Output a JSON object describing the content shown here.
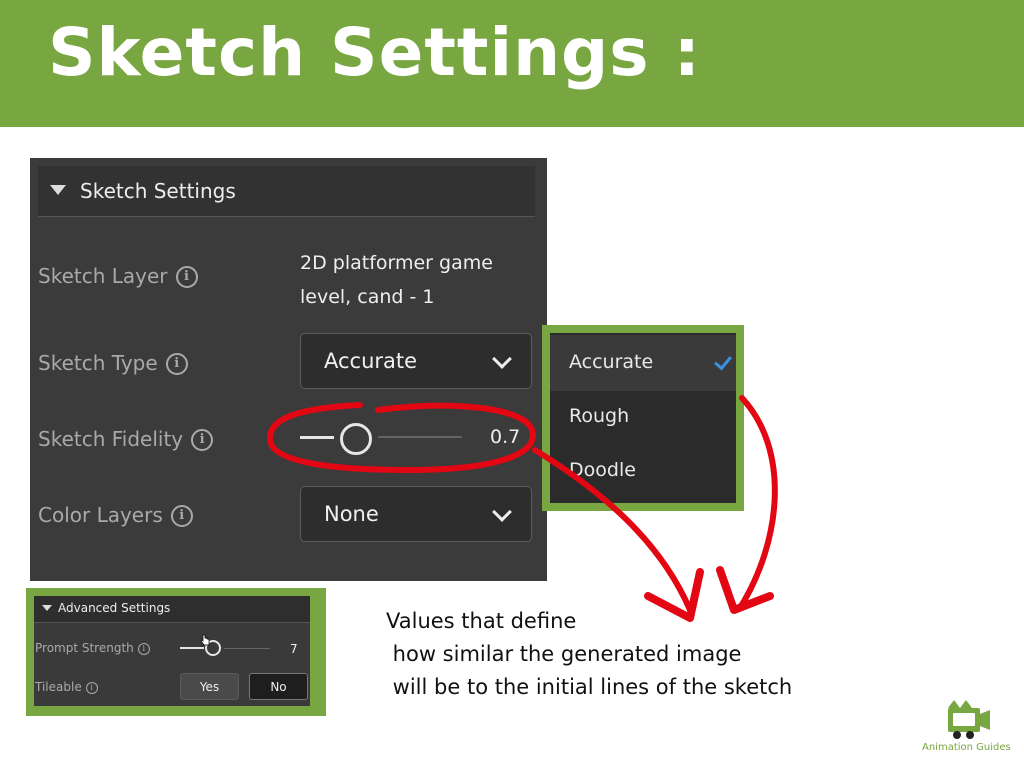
{
  "slide": {
    "title": "Sketch Settings :",
    "header_color": "#78a640",
    "caption_lines": [
      "Values that define",
      " how similar the generated image",
      " will be to the initial lines of the sketch"
    ]
  },
  "panel": {
    "section_title": "Sketch Settings",
    "sketch_layer": {
      "label": "Sketch Layer",
      "value_line1": "2D platformer game",
      "value_line2": "level, cand - 1"
    },
    "sketch_type": {
      "label": "Sketch Type",
      "value": "Accurate"
    },
    "sketch_fidelity": {
      "label": "Sketch Fidelity",
      "value": "0.7",
      "level": 0.7
    },
    "color_layers": {
      "label": "Color Layers",
      "value": "None"
    },
    "info_glyph": "i"
  },
  "dropdown_menu": {
    "items": [
      {
        "label": "Accurate",
        "selected": true
      },
      {
        "label": "Rough",
        "selected": false
      },
      {
        "label": "Doodle",
        "selected": false
      }
    ],
    "check_color": "#3d8fe0"
  },
  "advanced": {
    "section_title": "Advanced Settings",
    "prompt_strength": {
      "label": "Prompt Strength",
      "value": "7"
    },
    "tileable": {
      "label": "Tileable",
      "yes_label": "Yes",
      "no_label": "No",
      "selected": "No"
    }
  },
  "annotation_color": "#e30613",
  "logo": {
    "text": "Animation Guides",
    "icon": "clapperboard-robot-icon"
  }
}
